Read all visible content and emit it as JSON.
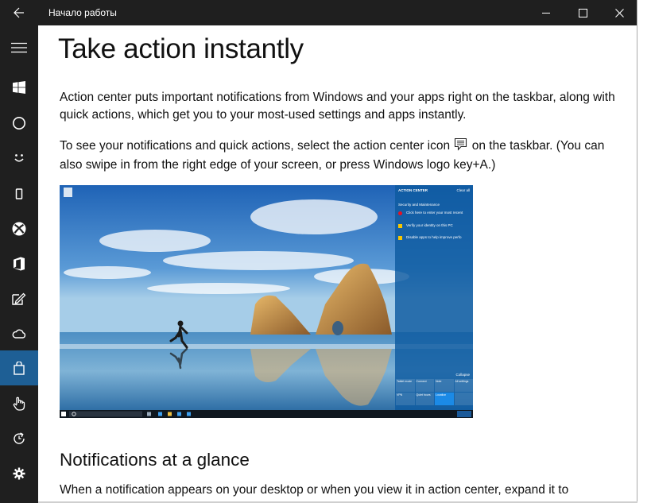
{
  "window": {
    "title": "Начало работы",
    "controls": [
      "minimize",
      "maximize",
      "close"
    ]
  },
  "sidebar": {
    "items": [
      {
        "icon": "hamburger-icon",
        "label": "Menu"
      },
      {
        "icon": "windows-logo-icon",
        "label": "Get started"
      },
      {
        "icon": "cortana-icon",
        "label": "Cortana"
      },
      {
        "icon": "smiley-icon",
        "label": "Personalization"
      },
      {
        "icon": "phone-icon",
        "label": "Phone"
      },
      {
        "icon": "xbox-icon",
        "label": "Xbox"
      },
      {
        "icon": "office-icon",
        "label": "Office"
      },
      {
        "icon": "ink-pen-icon",
        "label": "Windows Ink"
      },
      {
        "icon": "cloud-icon",
        "label": "OneDrive"
      },
      {
        "icon": "store-bag-icon",
        "label": "Store",
        "active": true
      },
      {
        "icon": "touch-hand-icon",
        "label": "Touch"
      },
      {
        "icon": "refresh-clock-icon",
        "label": "Updates"
      },
      {
        "icon": "gear-icon",
        "label": "Settings"
      }
    ]
  },
  "content": {
    "title": "Take action instantly",
    "p1": "Action center puts important notifications from Windows and your apps right on the taskbar, along with quick actions, which get you to your most-used settings and apps instantly.",
    "p2_before": "To see your notifications and quick actions, select the action center icon",
    "p2_after": " on the taskbar. (You can also swipe in from the right edge of your screen, or press Windows logo key+A.)",
    "section2_title": "Notifications at a glance",
    "p3": "When a notification appears on your desktop or when you view it in action center, expand it to"
  },
  "hero": {
    "action_center": {
      "title": "ACTION CENTER",
      "clear_all": "Clear all",
      "section": "Security and Maintenance",
      "notifications": [
        {
          "text": "Click here to enter your most recent",
          "kind": "error"
        },
        {
          "text": "Verify your identity on this PC",
          "kind": "warning"
        },
        {
          "text": "Disable apps to help improve perfo",
          "kind": "warning"
        }
      ],
      "collapse": "Collapse",
      "tiles": [
        "Tablet mode",
        "Connect",
        "Note",
        "All settings",
        "VPN",
        "Quiet hours",
        "Location",
        ""
      ]
    }
  },
  "colors": {
    "chrome": "#1f1f1f",
    "sidebar_active": "#1e5f95",
    "action_center": "#0e5aa0"
  }
}
